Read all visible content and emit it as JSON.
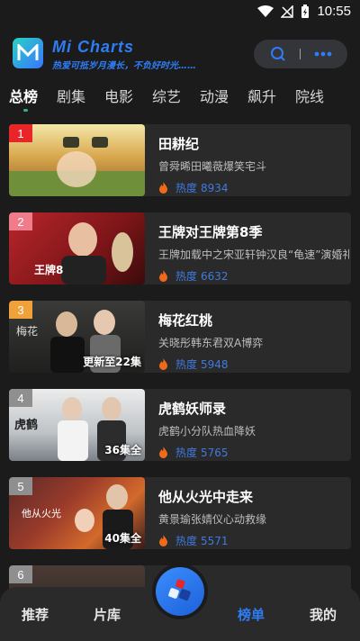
{
  "status": {
    "time": "10:55"
  },
  "header": {
    "app_title": "Mi Charts",
    "slogan": "热爱可抵岁月漫长，不负好时光……"
  },
  "tabs": [
    {
      "label": "总榜",
      "active": true
    },
    {
      "label": "剧集",
      "active": false
    },
    {
      "label": "电影",
      "active": false
    },
    {
      "label": "综艺",
      "active": false
    },
    {
      "label": "动漫",
      "active": false
    },
    {
      "label": "飙升",
      "active": false
    },
    {
      "label": "院线",
      "active": false
    }
  ],
  "heat_label": "热度",
  "items": [
    {
      "rank": "1",
      "title": "田耕纪",
      "desc": "曾舜晞田曦薇爆笑宅斗",
      "heat": "8934",
      "episode": "",
      "badge_color": "#e8262a"
    },
    {
      "rank": "2",
      "title": "王牌对王牌第8季",
      "desc": "王牌加载中之宋亚轩钟汉良“龟速”演婚礼",
      "heat": "6632",
      "episode": "",
      "badge_color": "#f07b8a"
    },
    {
      "rank": "3",
      "title": "梅花红桃",
      "desc": "关晓彤韩东君双A博弈",
      "heat": "5948",
      "episode": "更新至22集",
      "badge_color": "#f0a23a"
    },
    {
      "rank": "4",
      "title": "虎鹤妖师录",
      "desc": "虎鹤小分队热血降妖",
      "heat": "5765",
      "episode": "36集全",
      "badge_color": "#8f8f8f"
    },
    {
      "rank": "5",
      "title": "他从火光中走来",
      "desc": "黄景瑜张婧仪心动救缘",
      "heat": "5571",
      "episode": "40集全",
      "badge_color": "#8f8f8f"
    },
    {
      "rank": "6",
      "title": "",
      "desc": "",
      "heat": "",
      "episode": "",
      "badge_color": "#8f8f8f"
    }
  ],
  "bottom_nav": {
    "recommend": "推荐",
    "library": "片库",
    "charts": "榜单",
    "mine": "我的"
  },
  "colors": {
    "accent": "#2f7df6",
    "background": "#1b1b1b",
    "card": "#2a2a2a"
  }
}
